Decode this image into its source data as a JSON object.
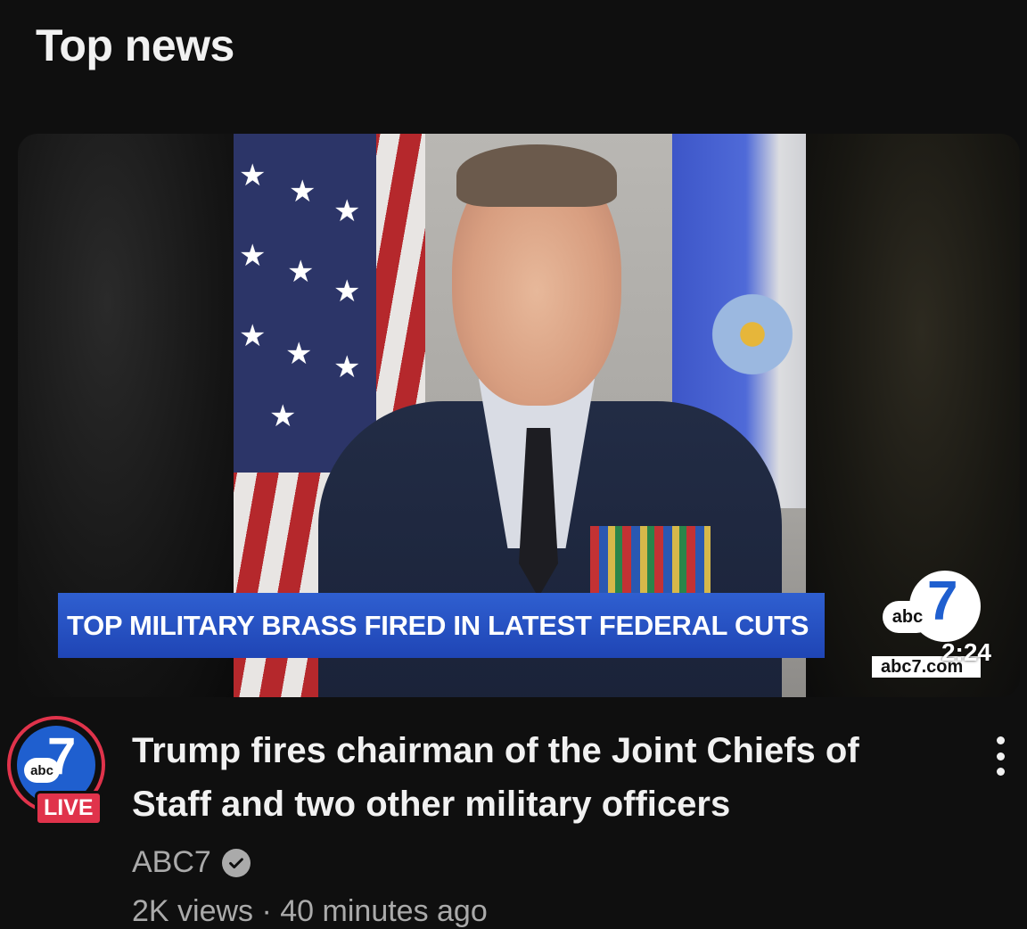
{
  "section": {
    "title": "Top news"
  },
  "video": {
    "chyron": "TOP MILITARY BRASS FIRED IN LATEST FEDERAL CUTS",
    "watermark_abc": "abc",
    "watermark_seven": "7",
    "watermark_domain": "abc7.com",
    "duration": "2:24",
    "title": "Trump fires chairman of the Joint Chiefs of Staff and two other military officers",
    "channel": "ABC7",
    "verified_icon": "check-circle-icon",
    "meta": "2K views · 40 minutes ago",
    "live_label": "LIVE",
    "avatar_abc": "abc",
    "avatar_seven": "7"
  },
  "colors": {
    "background": "#0f0f0f",
    "live_red": "#e0334b",
    "abc_blue": "#1f5fcf",
    "chyron_blue": "#2f5fd0",
    "secondary_text": "#aaaaaa"
  }
}
